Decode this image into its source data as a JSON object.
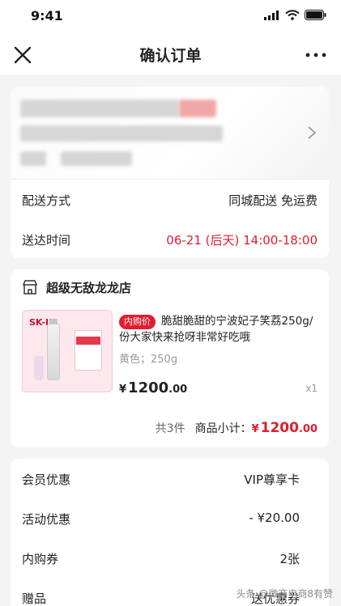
{
  "status_bar": {
    "time": "9:41"
  },
  "nav": {
    "title": "确认订单",
    "close_icon": "close-icon",
    "more_icon": "more-icon"
  },
  "delivery": {
    "method_label": "配送方式",
    "method_value": "同城配送 免运费",
    "time_label": "送达时间",
    "time_value": "06-21 (后天) 14:00-18:00"
  },
  "store": {
    "name": "超级无敌龙龙店",
    "product": {
      "image_brand": "SK-II",
      "tag": "内购价",
      "title": "脆甜脆甜的宁波妃子笑荔250g/份大家快来抢呀非常好吃哦",
      "spec": "黄色；250g",
      "currency": "¥",
      "price_int": "1200",
      "price_dec": ".00",
      "quantity": "x1"
    },
    "summary_count": "共3件",
    "summary_label": "商品小计：",
    "summary_currency": "¥",
    "summary_int": "1200",
    "summary_dec": ".00"
  },
  "promotions": {
    "member_label": "会员优惠",
    "member_value": "VIP尊享卡",
    "activity_label": "活动优惠",
    "activity_value": "- ¥20.00",
    "coupon_label": "内购券",
    "coupon_value": "2张",
    "gift_label": "赠品",
    "gift_value": "送优惠券"
  },
  "watermark": "头条 @微商电商8有赞",
  "colors": {
    "accent": "#e11d2e",
    "background": "#f4f4f4"
  }
}
